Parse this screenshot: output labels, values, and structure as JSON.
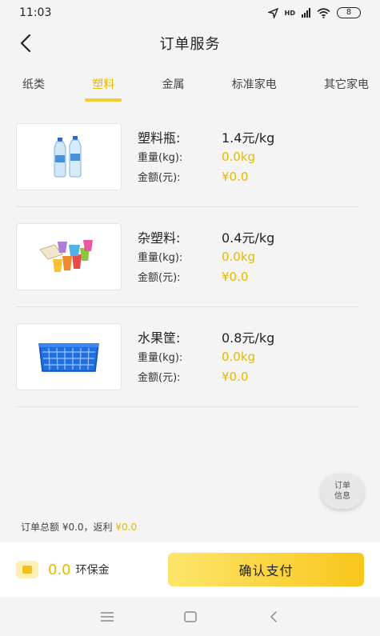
{
  "status_bar": {
    "time": "11:03",
    "network": "HD",
    "battery": "8"
  },
  "header": {
    "title": "订单服务"
  },
  "tabs": [
    {
      "label": "纸类",
      "active": false
    },
    {
      "label": "塑料",
      "active": true
    },
    {
      "label": "金属",
      "active": false
    },
    {
      "label": "标准家电",
      "active": false
    },
    {
      "label": "其它家电",
      "active": false
    }
  ],
  "items": [
    {
      "name": "塑料瓶:",
      "price": "1.4元/kg",
      "weight_label": "重量(kg):",
      "weight": "0.0kg",
      "amount_label": "金额(元):",
      "amount": "¥0.0",
      "icon": "plastic-bottles-icon"
    },
    {
      "name": "杂塑料:",
      "price": "0.4元/kg",
      "weight_label": "重量(kg):",
      "weight": "0.0kg",
      "amount_label": "金额(元):",
      "amount": "¥0.0",
      "icon": "mixed-plastics-icon"
    },
    {
      "name": "水果筐:",
      "price": "0.8元/kg",
      "weight_label": "重量(kg):",
      "weight": "0.0kg",
      "amount_label": "金额(元):",
      "amount": "¥0.0",
      "icon": "fruit-crate-icon"
    }
  ],
  "float_button": {
    "line1": "订单",
    "line2": "信息"
  },
  "summary": {
    "prefix": "订单总额 ¥0.0，返利 ",
    "rebate": "¥0.0"
  },
  "bottom": {
    "balance": "0.0",
    "balance_label": "环保金",
    "pay_label": "确认支付"
  },
  "colors": {
    "accent": "#e6b800",
    "button_start": "#fde56a",
    "button_end": "#f8c61c"
  }
}
